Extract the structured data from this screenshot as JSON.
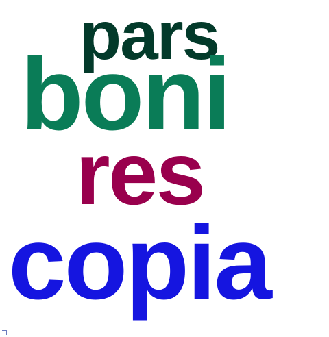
{
  "words": [
    {
      "text": "pars",
      "color": "#033a2a"
    },
    {
      "text": "boni",
      "color": "#0a7c57"
    },
    {
      "text": "res",
      "color": "#99004d"
    },
    {
      "text": "copia",
      "color": "#1515e0"
    }
  ]
}
